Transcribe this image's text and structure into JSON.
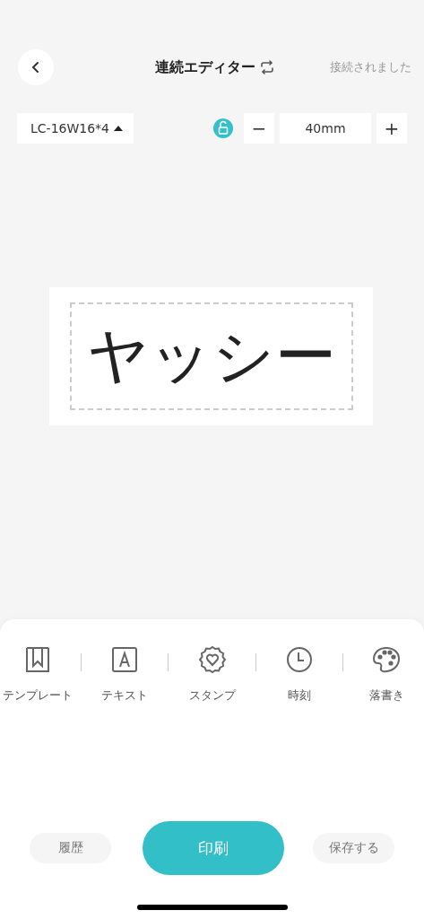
{
  "header": {
    "title": "連続エディター",
    "status": "接続されました"
  },
  "toolbar": {
    "tape": "LC-16W16*4",
    "locked": false,
    "length": "40mm",
    "minus": "−",
    "plus": "+"
  },
  "label": {
    "text": "ヤッシー"
  },
  "tools": [
    {
      "kind": "template",
      "label": "テンプレート"
    },
    {
      "kind": "text",
      "label": "テキスト"
    },
    {
      "kind": "stamp",
      "label": "スタンプ"
    },
    {
      "kind": "clock",
      "label": "時刻"
    },
    {
      "kind": "palette",
      "label": "落書き"
    }
  ],
  "actions": {
    "history": "履歴",
    "print": "印刷",
    "save": "保存する"
  }
}
